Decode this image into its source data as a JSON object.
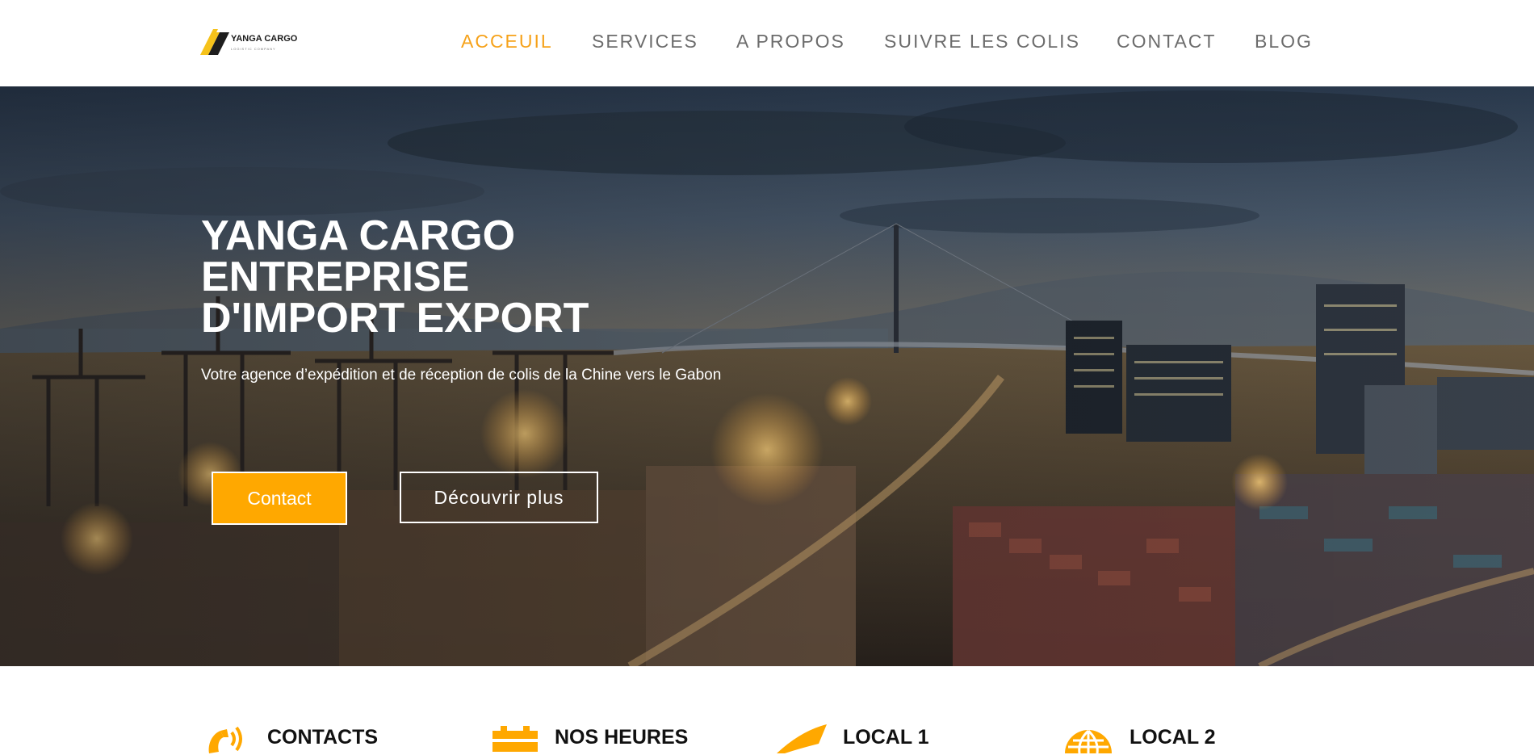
{
  "brand": {
    "name": "YANGA CARGO",
    "tagline": "LOGISTIC COMPANY",
    "accent_color": "#ffa800",
    "logo_icon": "yanga-cargo-logo"
  },
  "nav": {
    "items": [
      {
        "label": "ACCEUIL",
        "active": true
      },
      {
        "label": "SERVICES",
        "active": false
      },
      {
        "label": "A PROPOS",
        "active": false
      },
      {
        "label": "SUIVRE LES COLIS",
        "active": false
      },
      {
        "label": "CONTACT",
        "active": false
      },
      {
        "label": "BLOG",
        "active": false
      }
    ]
  },
  "hero": {
    "title_lines": [
      "YANGA CARGO",
      "ENTREPRISE",
      "D'IMPORT EXPORT"
    ],
    "subtitle": "Votre agence d’expédition et de réception de colis de la Chine vers le Gabon",
    "primary_button": "Contact",
    "secondary_button": "Découvrir plus",
    "background": "port-container-terminal-night-photo"
  },
  "info": {
    "items": [
      {
        "label": "CONTACTS",
        "icon": "phone-signal-icon"
      },
      {
        "label": "NOS HEURES",
        "icon": "calendar-icon"
      },
      {
        "label": "LOCAL 1",
        "icon": "location-marker-icon"
      },
      {
        "label": "LOCAL 2",
        "icon": "globe-icon"
      }
    ]
  }
}
